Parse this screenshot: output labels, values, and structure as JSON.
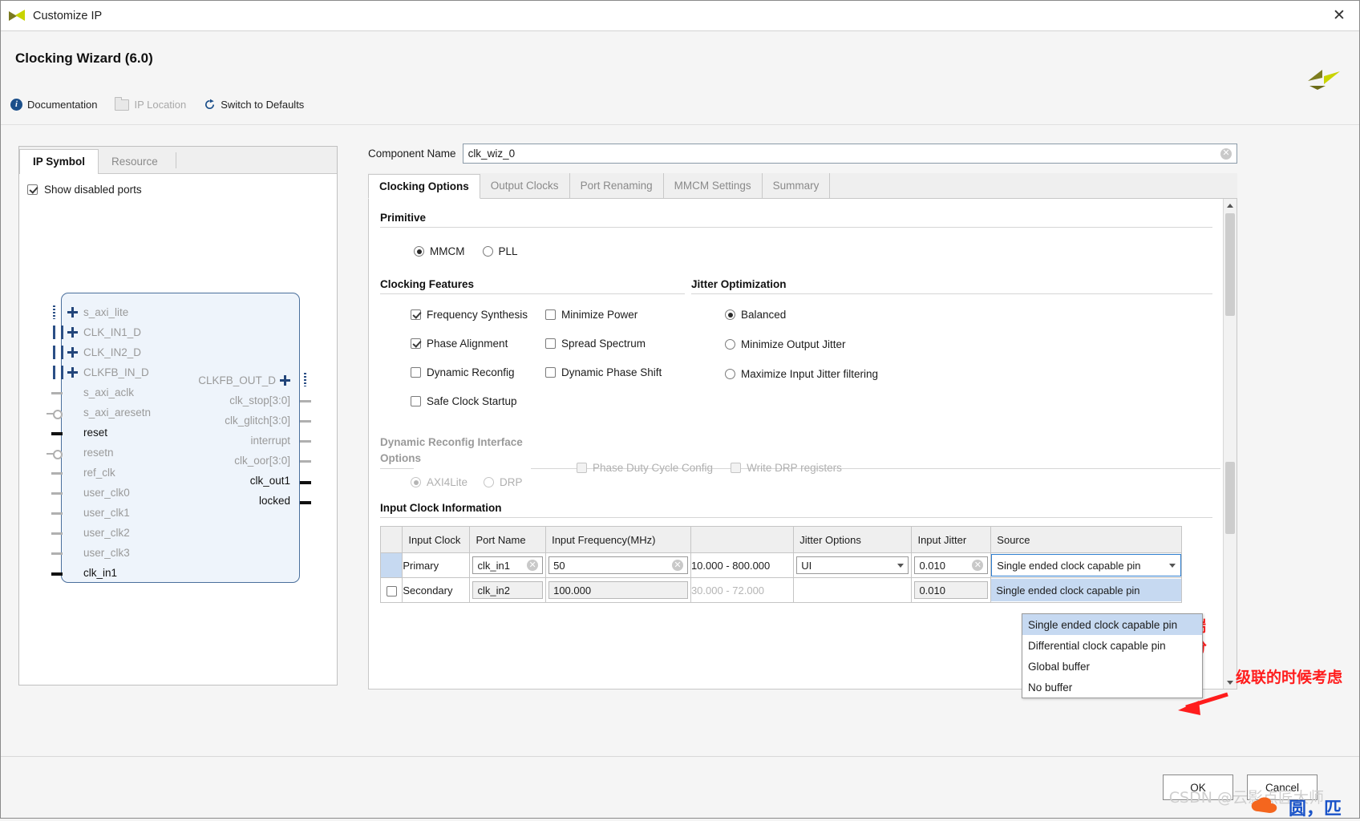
{
  "window": {
    "title": "Customize IP",
    "close_label": "✕",
    "logo_icon": "xilinx-logo-icon"
  },
  "header": {
    "title": "Clocking Wizard (6.0)",
    "toolbar": [
      {
        "label": "Documentation",
        "icon": "info-icon",
        "enabled": true
      },
      {
        "label": "IP Location",
        "icon": "folder-icon",
        "enabled": false
      },
      {
        "label": "Switch to Defaults",
        "icon": "refresh-icon",
        "enabled": true
      }
    ]
  },
  "left_panel": {
    "tabs": [
      {
        "label": "IP Symbol",
        "active": true
      },
      {
        "label": "Resource",
        "active": false
      }
    ],
    "show_disabled_ports": {
      "label": "Show disabled ports",
      "checked": true
    },
    "symbol": {
      "left_ports": [
        {
          "name": "s_axi_lite",
          "type": "bus-plus",
          "highlight": false
        },
        {
          "name": "CLK_IN1_D",
          "type": "bus-plus",
          "highlight": false
        },
        {
          "name": "CLK_IN2_D",
          "type": "bus-plus",
          "highlight": false
        },
        {
          "name": "CLKFB_IN_D",
          "type": "bus-plus",
          "highlight": false
        },
        {
          "name": "s_axi_aclk",
          "type": "pin",
          "highlight": false
        },
        {
          "name": "s_axi_aresetn",
          "type": "pin-inv",
          "highlight": false
        },
        {
          "name": "reset",
          "type": "pin",
          "highlight": true
        },
        {
          "name": "resetn",
          "type": "pin-inv",
          "highlight": false
        },
        {
          "name": "ref_clk",
          "type": "pin",
          "highlight": false
        },
        {
          "name": "user_clk0",
          "type": "pin",
          "highlight": false
        },
        {
          "name": "user_clk1",
          "type": "pin",
          "highlight": false
        },
        {
          "name": "user_clk2",
          "type": "pin",
          "highlight": false
        },
        {
          "name": "user_clk3",
          "type": "pin",
          "highlight": false
        },
        {
          "name": "clk_in1",
          "type": "pin",
          "highlight": true
        }
      ],
      "right_ports": [
        {
          "name": "CLKFB_OUT_D",
          "type": "bus-plus",
          "highlight": false
        },
        {
          "name": "clk_stop[3:0]",
          "type": "pin",
          "highlight": false
        },
        {
          "name": "clk_glitch[3:0]",
          "type": "pin",
          "highlight": false
        },
        {
          "name": "interrupt",
          "type": "pin",
          "highlight": false
        },
        {
          "name": "clk_oor[3:0]",
          "type": "pin",
          "highlight": false
        },
        {
          "name": "clk_out1",
          "type": "pin",
          "highlight": true
        },
        {
          "name": "locked",
          "type": "pin",
          "highlight": true
        }
      ]
    }
  },
  "component_name": {
    "label": "Component Name",
    "value": "clk_wiz_0"
  },
  "main_tabs": [
    {
      "label": "Clocking Options",
      "active": true
    },
    {
      "label": "Output Clocks",
      "active": false
    },
    {
      "label": "Port Renaming",
      "active": false
    },
    {
      "label": "MMCM Settings",
      "active": false
    },
    {
      "label": "Summary",
      "active": false
    }
  ],
  "primitive": {
    "title": "Primitive",
    "options": [
      {
        "label": "MMCM",
        "selected": true
      },
      {
        "label": "PLL",
        "selected": false
      }
    ]
  },
  "clocking_features": {
    "title": "Clocking Features",
    "items": [
      {
        "label": "Frequency Synthesis",
        "checked": true
      },
      {
        "label": "Minimize Power",
        "checked": false
      },
      {
        "label": "Phase Alignment",
        "checked": true
      },
      {
        "label": "Spread Spectrum",
        "checked": false
      },
      {
        "label": "Dynamic Reconfig",
        "checked": false
      },
      {
        "label": "Dynamic Phase Shift",
        "checked": false
      },
      {
        "label": "Safe Clock Startup",
        "checked": false
      }
    ]
  },
  "jitter_optimization": {
    "title": "Jitter Optimization",
    "options": [
      {
        "label": "Balanced",
        "selected": true
      },
      {
        "label": "Minimize Output Jitter",
        "selected": false
      },
      {
        "label": "Maximize Input Jitter filtering",
        "selected": false
      }
    ]
  },
  "dynamic_reconfig": {
    "title_line1": "Dynamic Reconfig Interface",
    "title_line2": "Options",
    "radios": [
      {
        "label": "AXI4Lite",
        "selected": true
      },
      {
        "label": "DRP",
        "selected": false
      }
    ],
    "checks": [
      {
        "label": "Phase Duty Cycle Config",
        "checked": false
      },
      {
        "label": "Write DRP registers",
        "checked": false
      }
    ]
  },
  "input_clock_information": {
    "title": "Input Clock Information",
    "columns": [
      "",
      "Input Clock",
      "Port Name",
      "Input Frequency(MHz)",
      "",
      "Jitter Options",
      "Input Jitter",
      "Source"
    ],
    "rows": [
      {
        "selected": true,
        "input_clock": "Primary",
        "port_name": "clk_in1",
        "input_frequency": "50",
        "frequency_range": "10.000 - 800.000",
        "jitter_options": "UI",
        "input_jitter": "0.010",
        "source": "Single ended clock capable pin"
      },
      {
        "selected": false,
        "input_clock": "Secondary",
        "port_name": "clk_in2",
        "input_frequency": "100.000",
        "frequency_range": "30.000 - 72.000",
        "jitter_options": "",
        "input_jitter": "0.010",
        "source": "Single ended clock capable pin"
      }
    ]
  },
  "source_dropdown": {
    "open": true,
    "items": [
      {
        "label": "Single ended clock capable pin",
        "selected": true
      },
      {
        "label": "Differential clock capable pin",
        "selected": false
      },
      {
        "label": "Global buffer",
        "selected": false
      },
      {
        "label": "No buffer",
        "selected": false
      }
    ]
  },
  "annotations": [
    {
      "text": "单端"
    },
    {
      "text": "差分"
    },
    {
      "text": "级联的时候考虑"
    }
  ],
  "footer": {
    "ok_label": "OK",
    "cancel_label": "Cancel"
  },
  "watermark": {
    "text": "CSDN @云影点匠大师"
  },
  "colors": {
    "accent_blue": "#2f7fd0",
    "selection_blue": "#c6d9f1",
    "annotation_red": "#ff1d1d",
    "symbol_fill": "#eef4fb",
    "symbol_border": "#4a6f9c"
  }
}
